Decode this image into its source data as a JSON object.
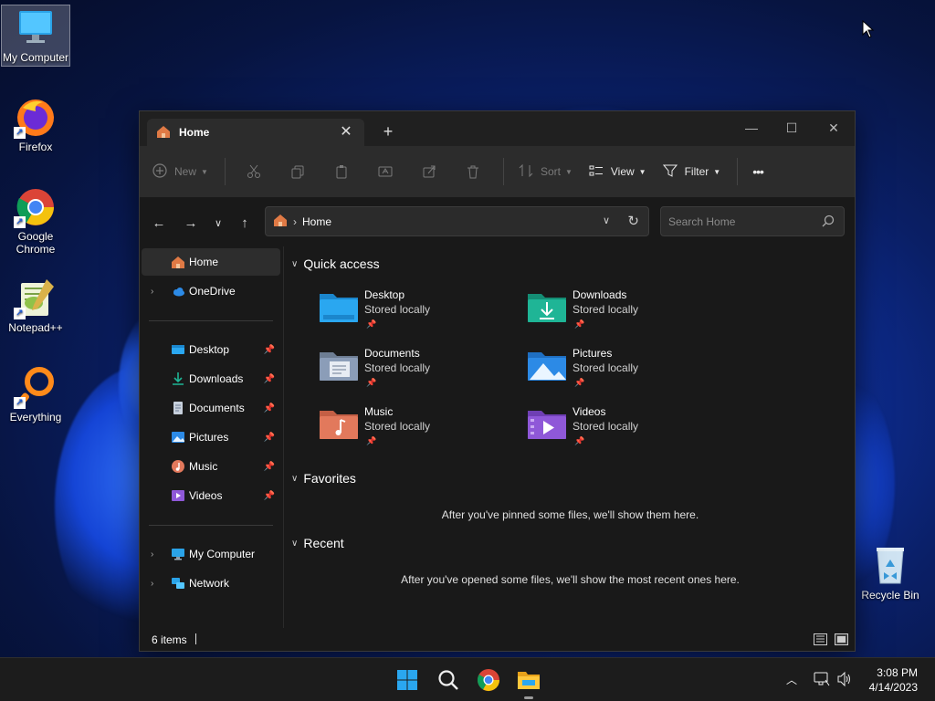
{
  "desktop": {
    "icons": [
      {
        "label": "My Computer",
        "icon": "monitor-icon",
        "selected": true
      },
      {
        "label": "Firefox",
        "icon": "firefox-icon"
      },
      {
        "label": "Google Chrome",
        "icon": "chrome-icon"
      },
      {
        "label": "Notepad++",
        "icon": "notepadpp-icon"
      },
      {
        "label": "Everything",
        "icon": "search-magnifier-icon"
      },
      {
        "label": "Recycle Bin",
        "icon": "recycle-bin-icon"
      }
    ]
  },
  "window": {
    "tab": {
      "label": "Home",
      "icon": "home-icon"
    },
    "controls": {
      "minimize": "—",
      "maximize": "☐",
      "close": "✕"
    },
    "toolbar": {
      "new_label": "New",
      "sort_label": "Sort",
      "view_label": "View",
      "filter_label": "Filter",
      "more_label": "•••",
      "icons": [
        "cut-icon",
        "copy-icon",
        "paste-icon",
        "rename-icon",
        "share-icon",
        "delete-icon"
      ]
    },
    "address": {
      "path": "Home",
      "separator": "›"
    },
    "search": {
      "placeholder": "Search Home"
    },
    "sidebar": {
      "top": [
        {
          "label": "Home",
          "icon": "home-icon",
          "selected": true
        },
        {
          "label": "OneDrive",
          "icon": "cloud-icon"
        }
      ],
      "pinned": [
        {
          "label": "Desktop",
          "icon": "desktop-folder-icon"
        },
        {
          "label": "Downloads",
          "icon": "download-icon"
        },
        {
          "label": "Documents",
          "icon": "document-icon"
        },
        {
          "label": "Pictures",
          "icon": "pictures-icon"
        },
        {
          "label": "Music",
          "icon": "music-icon"
        },
        {
          "label": "Videos",
          "icon": "video-icon"
        }
      ],
      "bottom": [
        {
          "label": "My Computer",
          "icon": "monitor-icon"
        },
        {
          "label": "Network",
          "icon": "network-icon"
        }
      ]
    },
    "quick_access": {
      "title": "Quick access",
      "items": [
        {
          "name": "Desktop",
          "sub": "Stored locally",
          "color": "#2aa7f0"
        },
        {
          "name": "Downloads",
          "sub": "Stored locally",
          "color": "#1fb596"
        },
        {
          "name": "Documents",
          "sub": "Stored locally",
          "color": "#8b9db8"
        },
        {
          "name": "Pictures",
          "sub": "Stored locally",
          "color": "#2c8ae6"
        },
        {
          "name": "Music",
          "sub": "Stored locally",
          "color": "#e2795c"
        },
        {
          "name": "Videos",
          "sub": "Stored locally",
          "color": "#8f58d8"
        }
      ]
    },
    "favorites": {
      "title": "Favorites",
      "message": "After you've pinned some files, we'll show them here."
    },
    "recent": {
      "title": "Recent",
      "message": "After you've opened some files, we'll show the most recent ones here."
    },
    "status": {
      "count": "6 items"
    }
  },
  "taskbar": {
    "apps": [
      "start-icon",
      "search-icon",
      "chrome-icon",
      "file-explorer-icon"
    ],
    "time": "3:08 PM",
    "date": "4/14/2023"
  }
}
